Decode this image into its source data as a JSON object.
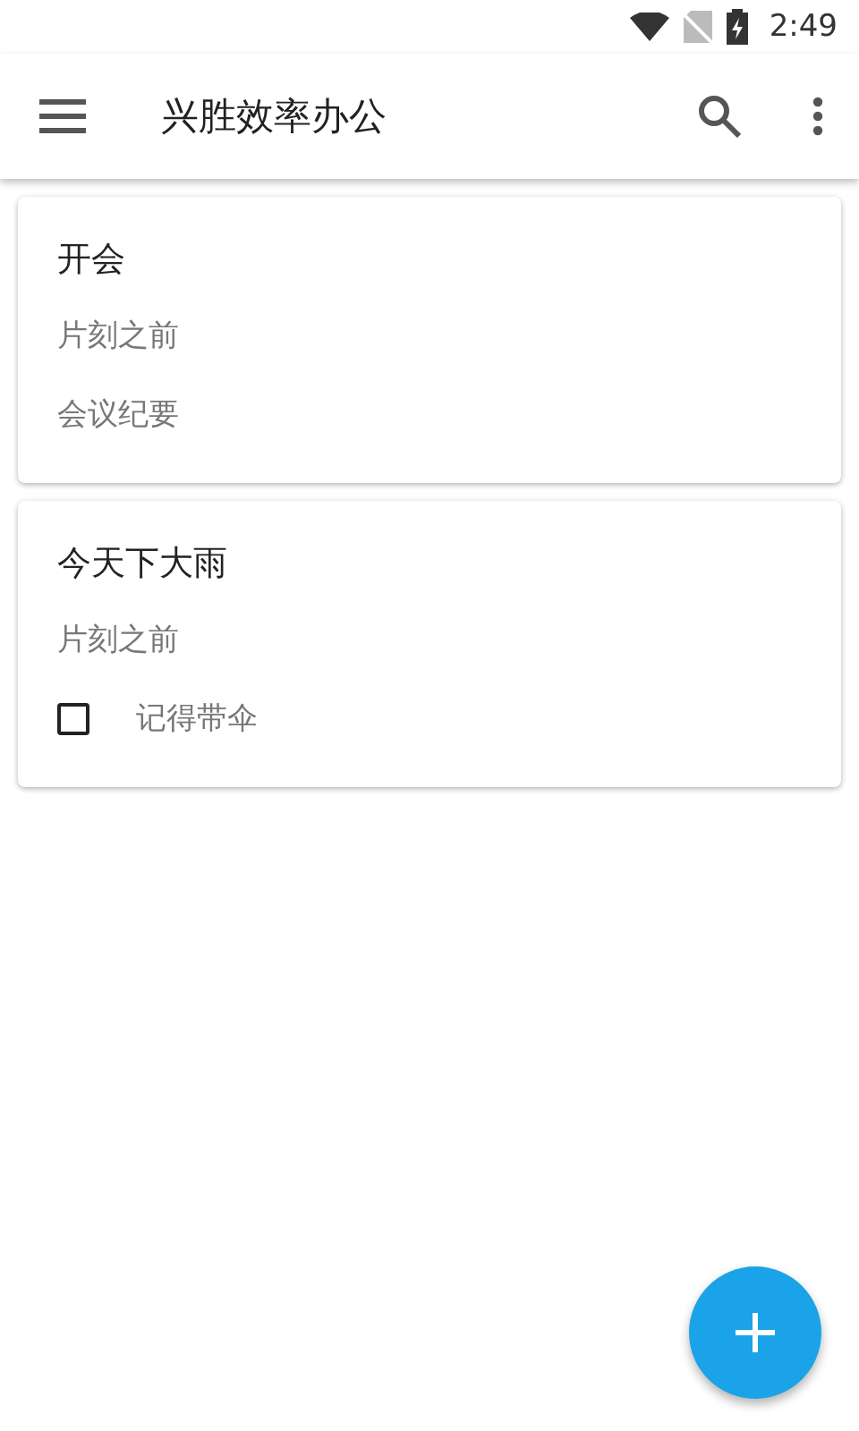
{
  "status_bar": {
    "time": "2:49"
  },
  "app_bar": {
    "title": "兴胜效率办公"
  },
  "notes": [
    {
      "title": "开会",
      "time": "片刻之前",
      "items": [
        {
          "kind": "text",
          "text": "会议纪要"
        }
      ]
    },
    {
      "title": "今天下大雨",
      "time": "片刻之前",
      "items": [
        {
          "kind": "checkbox",
          "text": "记得带伞",
          "checked": false
        }
      ]
    }
  ]
}
